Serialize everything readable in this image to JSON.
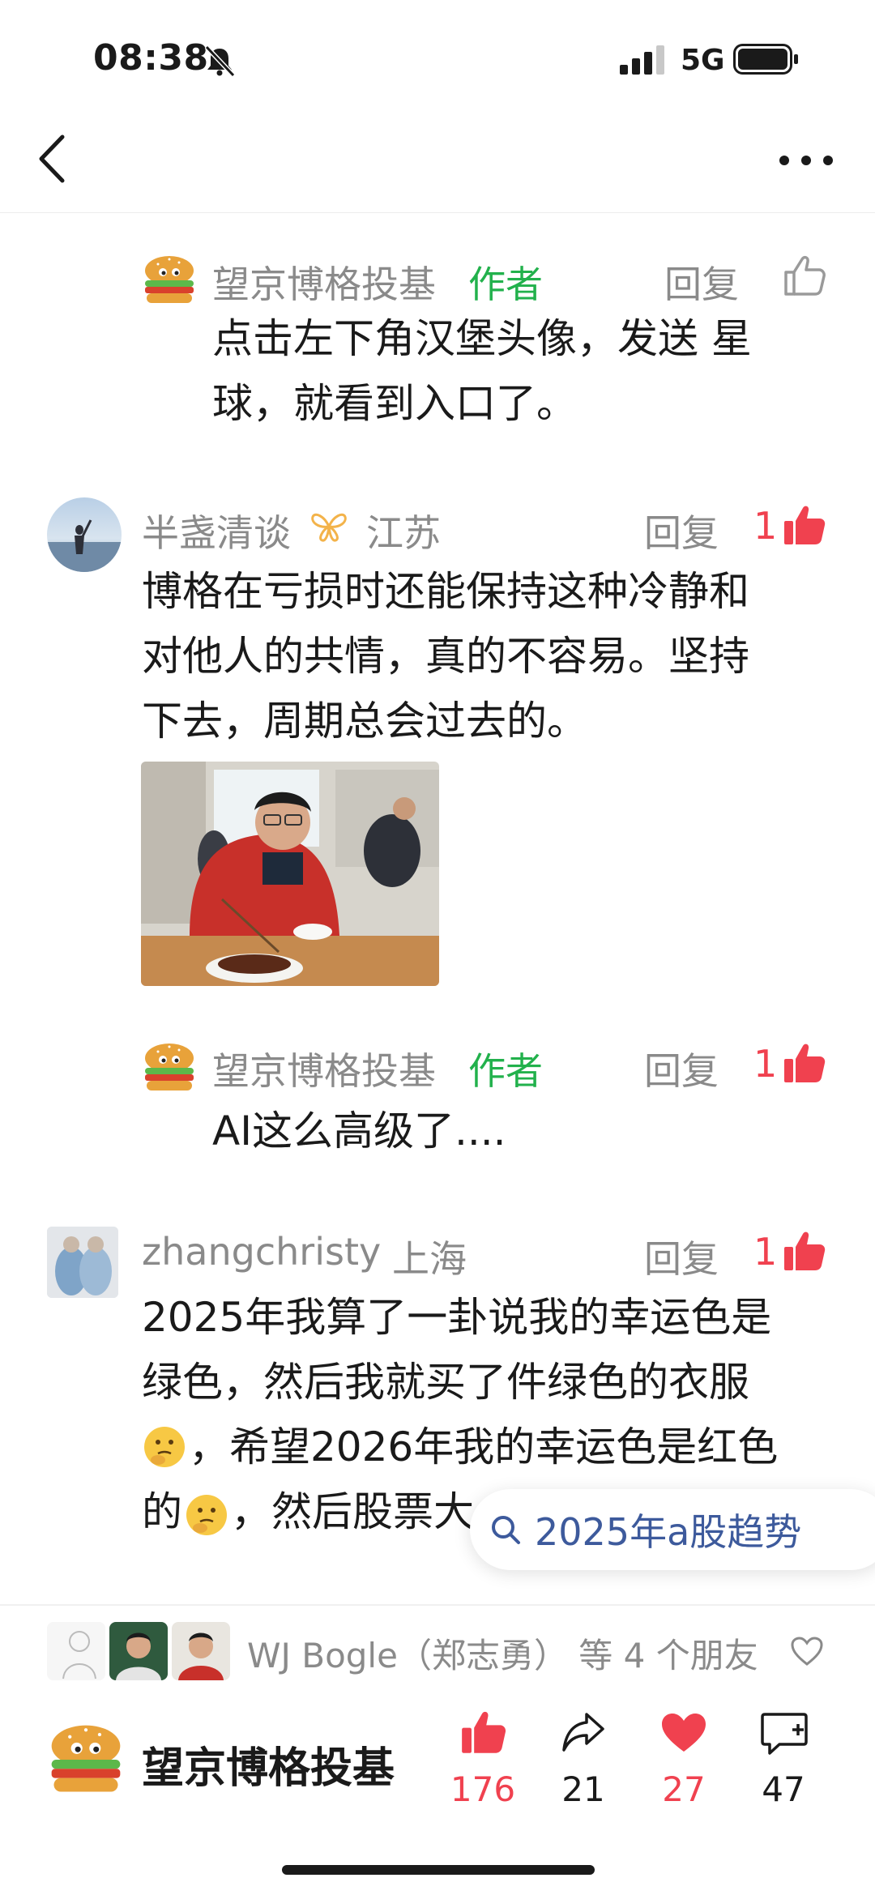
{
  "status_bar": {
    "time": "08:38",
    "network": "5G"
  },
  "comments": [
    {
      "user": "望京博格投基",
      "author_tag": "作者",
      "reply_label": "回复",
      "likes": "",
      "text_lines": [
        "点击左下角汉堡头像，发送 星",
        "球，就看到入口了。"
      ]
    },
    {
      "user": "半盏清谈",
      "region": "江苏",
      "reply_label": "回复",
      "likes": "1",
      "text_lines": [
        "博格在亏损时还能保持这种冷静和",
        "对他人的共情，真的不容易。坚持",
        "下去，周期总会过去的。"
      ]
    },
    {
      "user": "望京博格投基",
      "author_tag": "作者",
      "reply_label": "回复",
      "likes": "1",
      "text_lines": [
        "AI这么高级了...."
      ]
    },
    {
      "user": "zhangchristy",
      "region": "上海",
      "reply_label": "回复",
      "likes": "1",
      "text_lines": [
        "2025年我算了一卦说我的幸运色是",
        "绿色，然后我就买了件绿色的衣服",
        "，希望2026年我的幸运色是红色",
        "的，然后股票大"
      ]
    }
  ],
  "search_chip": {
    "text": "2025年a股趋势"
  },
  "friends": {
    "text": "WJ Bogle（郑志勇） 等 4 个朋友"
  },
  "bottom_bar": {
    "blogger_name": "望京博格投基",
    "actions": [
      {
        "icon": "thumbs-up-icon",
        "count": "176",
        "color": "#f0414f"
      },
      {
        "icon": "share-icon",
        "count": "21",
        "color": "#1a1a1a"
      },
      {
        "icon": "heart-icon",
        "count": "27",
        "color": "#f0414f"
      },
      {
        "icon": "comment-icon",
        "count": "47",
        "color": "#1a1a1a"
      }
    ]
  },
  "colors": {
    "accent_red": "#f0414f",
    "author_green": "#22b14c",
    "search_blue": "#3d5a9c"
  }
}
